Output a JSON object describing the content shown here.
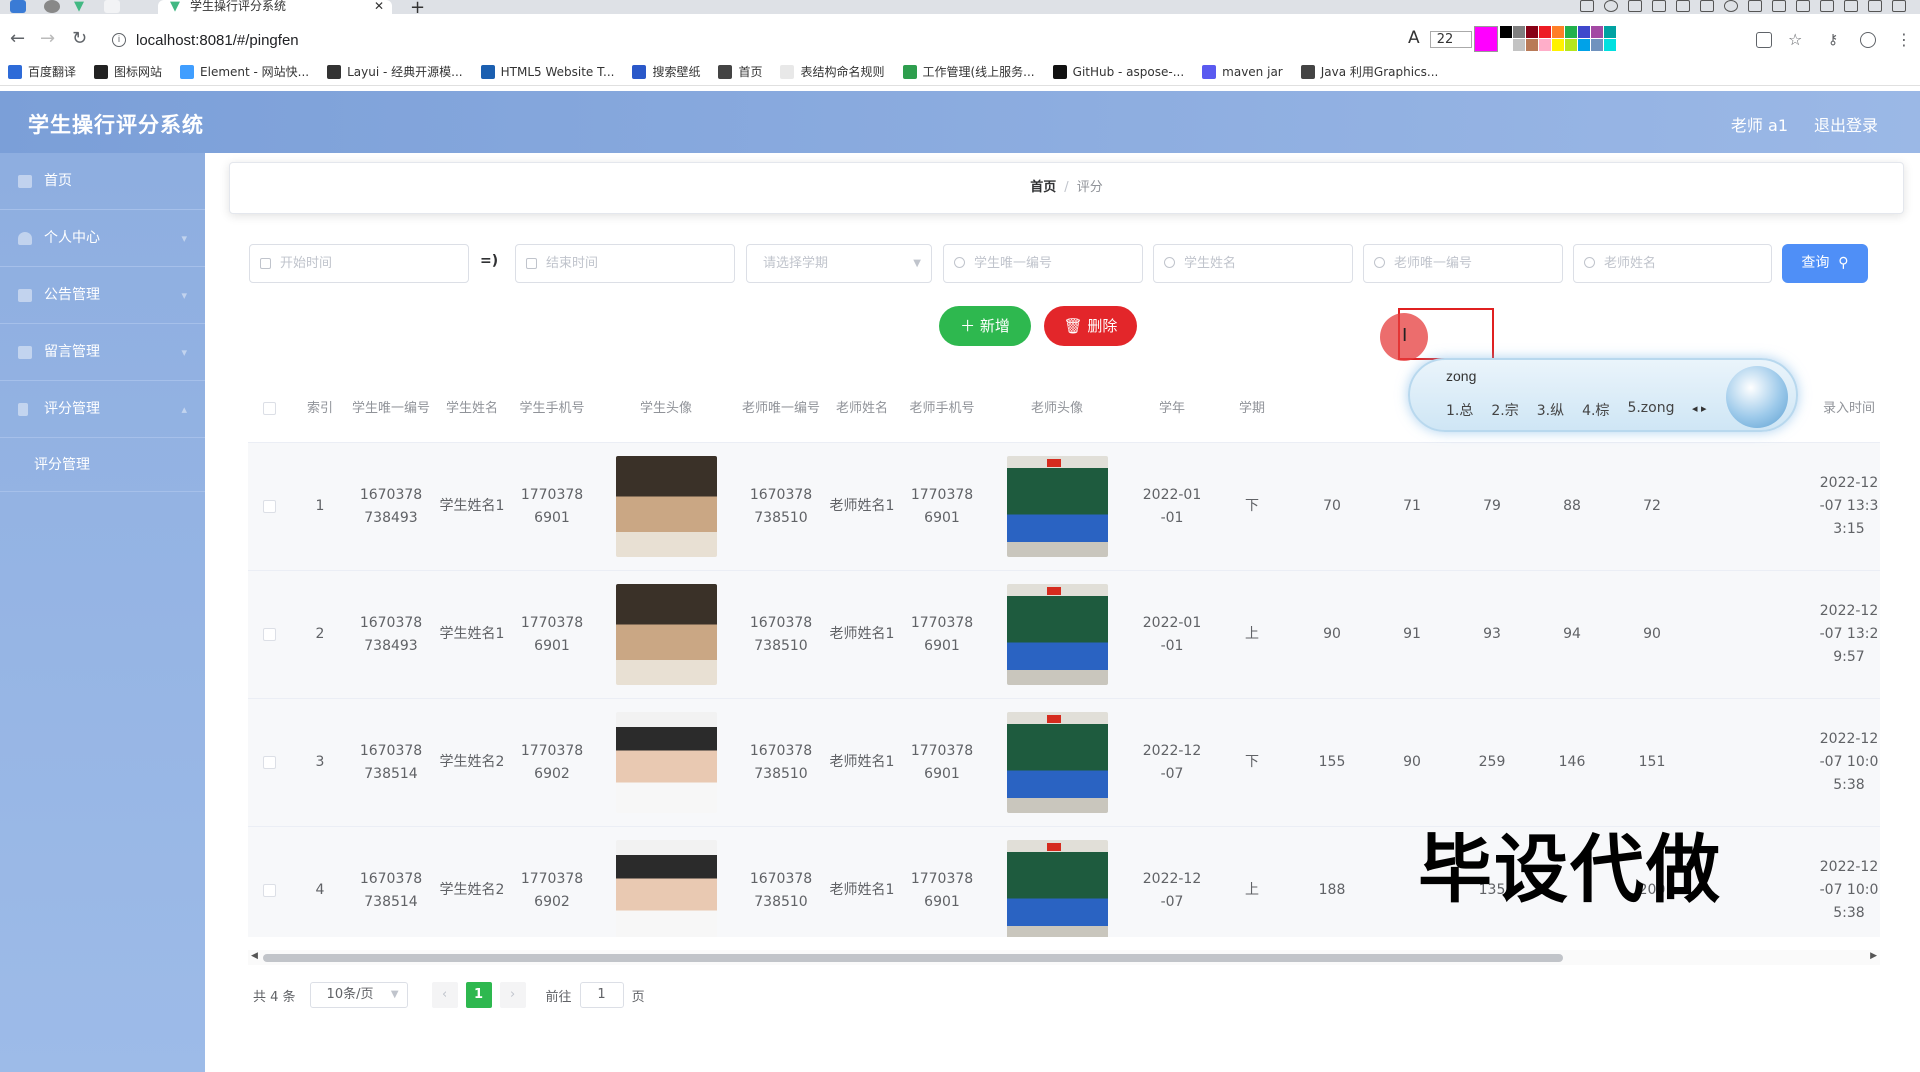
{
  "browser": {
    "tab_title": "学生操行评分系统",
    "tab_close": "✕",
    "new_tab": "+",
    "url": "localhost:8081/#/pingfen",
    "font_size": "22",
    "bookmarks": [
      {
        "label": "百度翻译",
        "color": "#2e6bd8"
      },
      {
        "label": "图标网站",
        "color": "#222222"
      },
      {
        "label": "Element - 网站快...",
        "color": "#409eff"
      },
      {
        "label": "Layui - 经典开源模...",
        "color": "#333333"
      },
      {
        "label": "HTML5 Website T...",
        "color": "#1b5fb0"
      },
      {
        "label": "搜索壁纸",
        "color": "#2a58c9"
      },
      {
        "label": "首页",
        "color": "#444444"
      },
      {
        "label": "表结构命名规则",
        "color": "#e8e8e8"
      },
      {
        "label": "工作管理(线上服务...",
        "color": "#2e9e4e"
      },
      {
        "label": "GitHub - aspose-...",
        "color": "#111111"
      },
      {
        "label": "maven jar",
        "color": "#5a5af0"
      },
      {
        "label": "Java 利用Graphics...",
        "color": "#444444"
      }
    ],
    "palette_colors": [
      "#000000",
      "#7f7f7f",
      "#880015",
      "#ed1c24",
      "#ff7f27",
      "#22b14c",
      "#3f48cc",
      "#a349a4",
      "#00a2a2",
      "#ffffff",
      "#c3c3c3",
      "#b97a57",
      "#ffaec9",
      "#fff200",
      "#b5e61d",
      "#00a2e8",
      "#7092be",
      "#00e0e0"
    ]
  },
  "app": {
    "title": "学生操行评分系统",
    "user": "老师 a1",
    "logout": "退出登录"
  },
  "sidebar": {
    "items": [
      {
        "label": "首页",
        "has_children": false
      },
      {
        "label": "个人中心",
        "has_children": true
      },
      {
        "label": "公告管理",
        "has_children": true
      },
      {
        "label": "留言管理",
        "has_children": true
      },
      {
        "label": "评分管理",
        "has_children": true
      }
    ],
    "sub_item": "评分管理"
  },
  "breadcrumb": {
    "home": "首页",
    "sep": "/",
    "current": "评分"
  },
  "filters": {
    "start_time": "开始时间",
    "range_sep": "=)",
    "end_time": "结束时间",
    "semester": "请选择学期",
    "student_id": "学生唯一编号",
    "student_name": "学生姓名",
    "teacher_id": "老师唯一编号",
    "teacher_name": "老师姓名",
    "query": "查询"
  },
  "actions": {
    "add": "新增",
    "delete": "删除"
  },
  "table": {
    "headers": [
      "索引",
      "学生唯一编号",
      "学生姓名",
      "学生手机号",
      "学生头像",
      "老师唯一编号",
      "老师姓名",
      "老师手机号",
      "老师头像",
      "学年",
      "学期",
      "",
      "",
      "",
      "",
      "",
      "录入时间"
    ],
    "rows": [
      {
        "index": "1",
        "sid": "1670378738493",
        "sname": "学生姓名1",
        "sphone": "17703786901",
        "savatar": "stu1",
        "tid": "1670378738510",
        "tname": "老师姓名1",
        "tphone": "17703786901",
        "year": "2022-01-01",
        "term": "下",
        "s1": "70",
        "s2": "71",
        "s3": "79",
        "s4": "88",
        "s5": "72",
        "time": "2022-12-07 13:33:15"
      },
      {
        "index": "2",
        "sid": "1670378738493",
        "sname": "学生姓名1",
        "sphone": "17703786901",
        "savatar": "stu1",
        "tid": "1670378738510",
        "tname": "老师姓名1",
        "tphone": "17703786901",
        "year": "2022-01-01",
        "term": "上",
        "s1": "90",
        "s2": "91",
        "s3": "93",
        "s4": "94",
        "s5": "90",
        "time": "2022-12-07 13:29:57"
      },
      {
        "index": "3",
        "sid": "1670378738514",
        "sname": "学生姓名2",
        "sphone": "17703786902",
        "savatar": "stu2",
        "tid": "1670378738510",
        "tname": "老师姓名1",
        "tphone": "17703786901",
        "year": "2022-12-07",
        "term": "下",
        "s1": "155",
        "s2": "90",
        "s3": "259",
        "s4": "146",
        "s5": "151",
        "time": "2022-12-07 10:05:38"
      },
      {
        "index": "4",
        "sid": "1670378738514",
        "sname": "学生姓名2",
        "sphone": "17703786902",
        "savatar": "stu2",
        "tid": "1670378738510",
        "tname": "老师姓名1",
        "tphone": "17703786901",
        "year": "2022-12-07",
        "term": "上",
        "s1": "188",
        "s2": "",
        "s3": "135",
        "s4": "",
        "s5": "200",
        "time": "2022-12-07 10:05:38"
      }
    ]
  },
  "pagination": {
    "total": "共 4 条",
    "page_size": "10条/页",
    "current": "1",
    "goto_prefix": "前往",
    "goto_value": "1",
    "goto_suffix": "页"
  },
  "ime": {
    "input": "zong",
    "candidates": [
      "1.总",
      "2.宗",
      "3.纵",
      "4.棕",
      "5.zong"
    ]
  },
  "watermark": "毕设代做"
}
